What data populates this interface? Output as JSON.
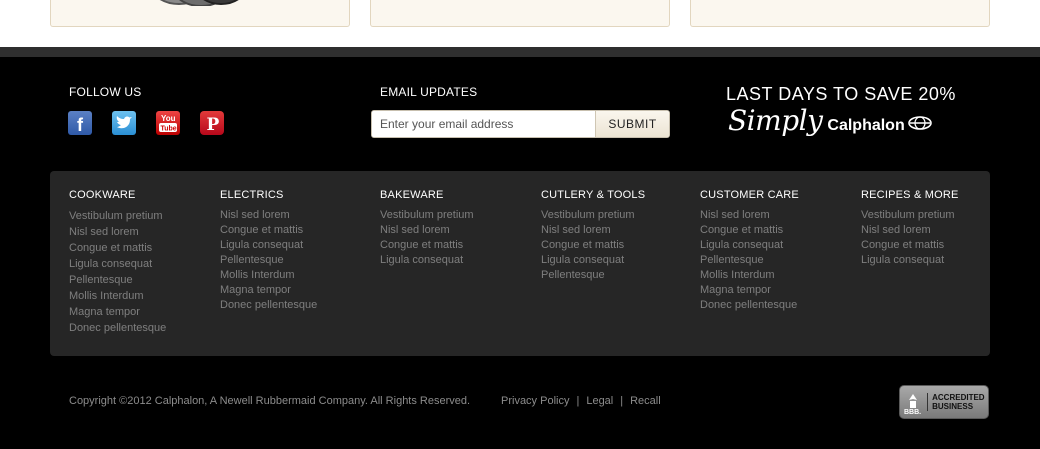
{
  "follow": {
    "title": "FOLLOW US",
    "icons": [
      "facebook-icon",
      "twitter-icon",
      "youtube-icon",
      "pinterest-icon"
    ],
    "youtube_text_1": "You",
    "youtube_text_2": "Tube"
  },
  "email": {
    "title": "EMAIL UPDATES",
    "placeholder": "Enter your email address",
    "submit_label": "SUBMIT"
  },
  "promo": {
    "headline": "LAST DAYS TO SAVE 20%",
    "script": "Simply",
    "brand": "Calphalon"
  },
  "columns": [
    {
      "title": "COOKWARE",
      "items": [
        "Vestibulum pretium",
        "Nisl sed lorem",
        "Congue et mattis",
        "Ligula consequat",
        "Pellentesque",
        "Mollis Interdum",
        "Magna tempor",
        "Donec pellentesque"
      ]
    },
    {
      "title": "ELECTRICS",
      "items": [
        "Nisl sed lorem",
        "Congue et mattis",
        "Ligula consequat",
        "Pellentesque",
        "Mollis Interdum",
        "Magna tempor",
        "Donec pellentesque"
      ]
    },
    {
      "title": "BAKEWARE",
      "items": [
        "Vestibulum pretium",
        "Nisl sed lorem",
        "Congue et mattis",
        "Ligula consequat"
      ]
    },
    {
      "title": "CUTLERY & TOOLS",
      "items": [
        "Vestibulum pretium",
        "Nisl sed lorem",
        "Congue et mattis",
        "Ligula consequat",
        "Pellentesque"
      ]
    },
    {
      "title": "CUSTOMER CARE",
      "items": [
        "Nisl sed lorem",
        "Congue et mattis",
        "Ligula consequat",
        "Pellentesque",
        "Mollis Interdum",
        "Magna tempor",
        "Donec pellentesque"
      ]
    },
    {
      "title": "RECIPES & MORE",
      "items": [
        "Vestibulum pretium",
        "Nisl sed lorem",
        "Congue et mattis",
        "Ligula consequat"
      ]
    }
  ],
  "footer": {
    "copyright": "Copyright ©2012 Calphalon, A Newell Rubbermaid Company. All Rights Reserved.",
    "links": [
      "Privacy Policy",
      "Legal",
      "Recall"
    ],
    "separator": "|"
  },
  "bbb": {
    "mark": "BBB.",
    "line1": "ACCREDITED",
    "line2": "BUSINESS"
  },
  "colors": {
    "background": "#000000",
    "panel": "#262626",
    "link_gray": "#7f7f7f",
    "card_bg": "#fbf7ef"
  }
}
